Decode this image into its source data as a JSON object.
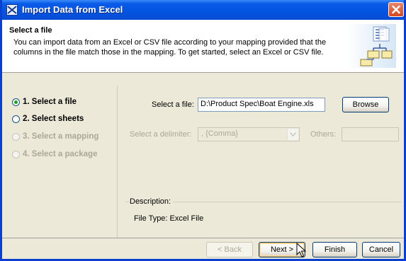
{
  "window": {
    "title": "Import Data from Excel",
    "icon": "app-icon",
    "close_icon": "close-icon"
  },
  "header": {
    "title": "Select a file",
    "description": "You can import data from an Excel or CSV file according to your mapping provided that the columns in the file match those in the mapping. To get started, select an Excel or CSV file.",
    "graphic": "spreadsheet-mapping-icon"
  },
  "steps": [
    {
      "label": "1. Select a file",
      "checked": true,
      "enabled": true
    },
    {
      "label": "2. Select sheets",
      "checked": false,
      "enabled": true
    },
    {
      "label": "3. Select a mapping",
      "checked": false,
      "enabled": false
    },
    {
      "label": "4. Select a package",
      "checked": false,
      "enabled": false
    }
  ],
  "form": {
    "file_label": "Select a file:",
    "file_value": "D:\\Product Spec\\Boat Engine.xls",
    "browse_label": "Browse",
    "delimiter_label": "Select a delimiter:",
    "delimiter_value": ", {Comma}",
    "others_label": "Others:",
    "others_value": ""
  },
  "description": {
    "label": "Description:",
    "text": "File Type: Excel File"
  },
  "buttons": {
    "back": "< Back",
    "next": "Next >",
    "finish": "Finish",
    "cancel": "Cancel"
  },
  "colors": {
    "titlebar": "#0354e0",
    "dialog_bg": "#ece9d8",
    "radio_check": "#21a121",
    "disabled_text": "#aca899"
  }
}
